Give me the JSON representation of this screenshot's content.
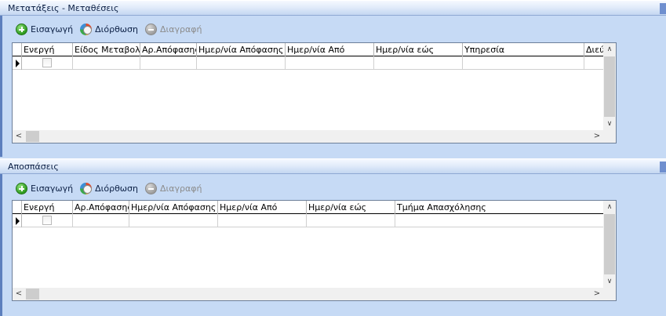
{
  "sections": [
    {
      "title": "Μετατάξεις - Μεταθέσεις",
      "toolbar": {
        "add": "Εισαγωγή",
        "edit": "Διόρθωση",
        "delete": "Διαγραφή"
      },
      "columns": [
        "Ενεργή",
        "Είδος Μεταβολής",
        "Αρ.Απόφασης",
        "Ημερ/νία Απόφασης",
        "Ημερ/νία Από",
        "Ημερ/νία εώς",
        "Υπηρεσία",
        "Διεύ"
      ]
    },
    {
      "title": "Αποσπάσεις",
      "toolbar": {
        "add": "Εισαγωγή",
        "edit": "Διόρθωση",
        "delete": "Διαγραφή"
      },
      "columns": [
        "Ενεργή",
        "Αρ.Απόφασης",
        "Ημερ/νία Απόφασης",
        "Ημερ/νία Από",
        "Ημερ/νία εώς",
        "Τμήμα Απασχόλησης"
      ]
    }
  ],
  "icons": {
    "add": "add-circle-icon",
    "edit": "edit-refresh-icon",
    "delete": "remove-circle-icon"
  },
  "colors": {
    "background": "#c6daf5",
    "header_text": "#0b1f44",
    "disabled_text": "#8c8c8c"
  }
}
